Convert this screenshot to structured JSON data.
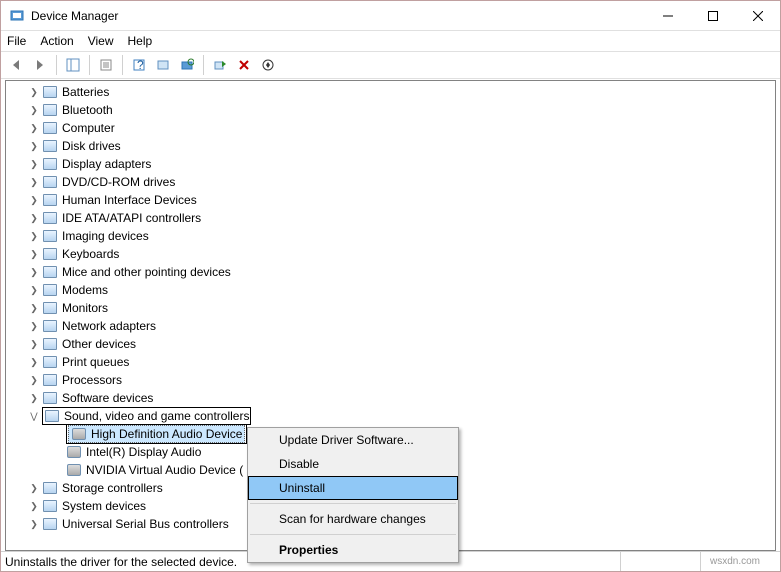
{
  "window": {
    "title": "Device Manager"
  },
  "menu": {
    "file": "File",
    "action": "Action",
    "view": "View",
    "help": "Help"
  },
  "tree": {
    "items": [
      {
        "label": "Batteries"
      },
      {
        "label": "Bluetooth"
      },
      {
        "label": "Computer"
      },
      {
        "label": "Disk drives"
      },
      {
        "label": "Display adapters"
      },
      {
        "label": "DVD/CD-ROM drives"
      },
      {
        "label": "Human Interface Devices"
      },
      {
        "label": "IDE ATA/ATAPI controllers"
      },
      {
        "label": "Imaging devices"
      },
      {
        "label": "Keyboards"
      },
      {
        "label": "Mice and other pointing devices"
      },
      {
        "label": "Modems"
      },
      {
        "label": "Monitors"
      },
      {
        "label": "Network adapters"
      },
      {
        "label": "Other devices"
      },
      {
        "label": "Print queues"
      },
      {
        "label": "Processors"
      },
      {
        "label": "Software devices"
      }
    ],
    "expanded": {
      "label": "Sound, video and game controllers",
      "children": [
        {
          "label": "High Definition Audio Device"
        },
        {
          "label": "Intel(R) Display Audio"
        },
        {
          "label": "NVIDIA Virtual Audio Device ("
        }
      ]
    },
    "after": [
      {
        "label": "Storage controllers"
      },
      {
        "label": "System devices"
      },
      {
        "label": "Universal Serial Bus controllers"
      }
    ]
  },
  "context_menu": {
    "update": "Update Driver Software...",
    "disable": "Disable",
    "uninstall": "Uninstall",
    "scan": "Scan for hardware changes",
    "properties": "Properties"
  },
  "status": {
    "text": "Uninstalls the driver for the selected device."
  },
  "watermark": "wsxdn.com"
}
